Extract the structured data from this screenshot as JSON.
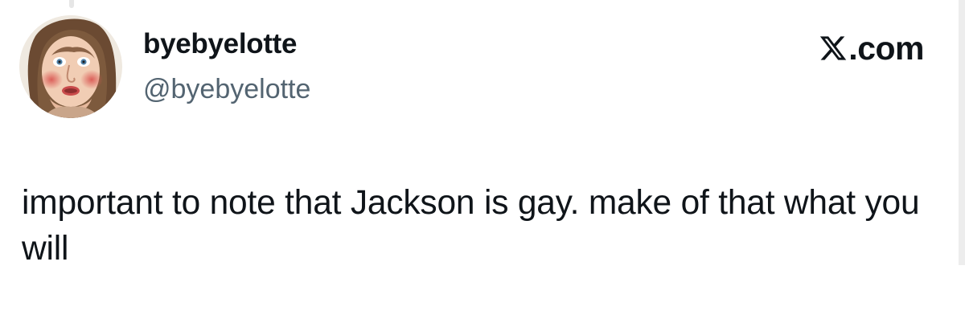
{
  "post": {
    "author": {
      "display_name": "byebyelotte",
      "handle": "@byebyelotte",
      "avatar_icon": "portrait-painting-avatar"
    },
    "brand": {
      "label": ".com",
      "icon": "x-logo-icon"
    },
    "text": "important to note that Jackson is gay. make of that what you will"
  },
  "colors": {
    "text_primary": "#0f1419",
    "text_secondary": "#536471",
    "background": "#ffffff"
  }
}
